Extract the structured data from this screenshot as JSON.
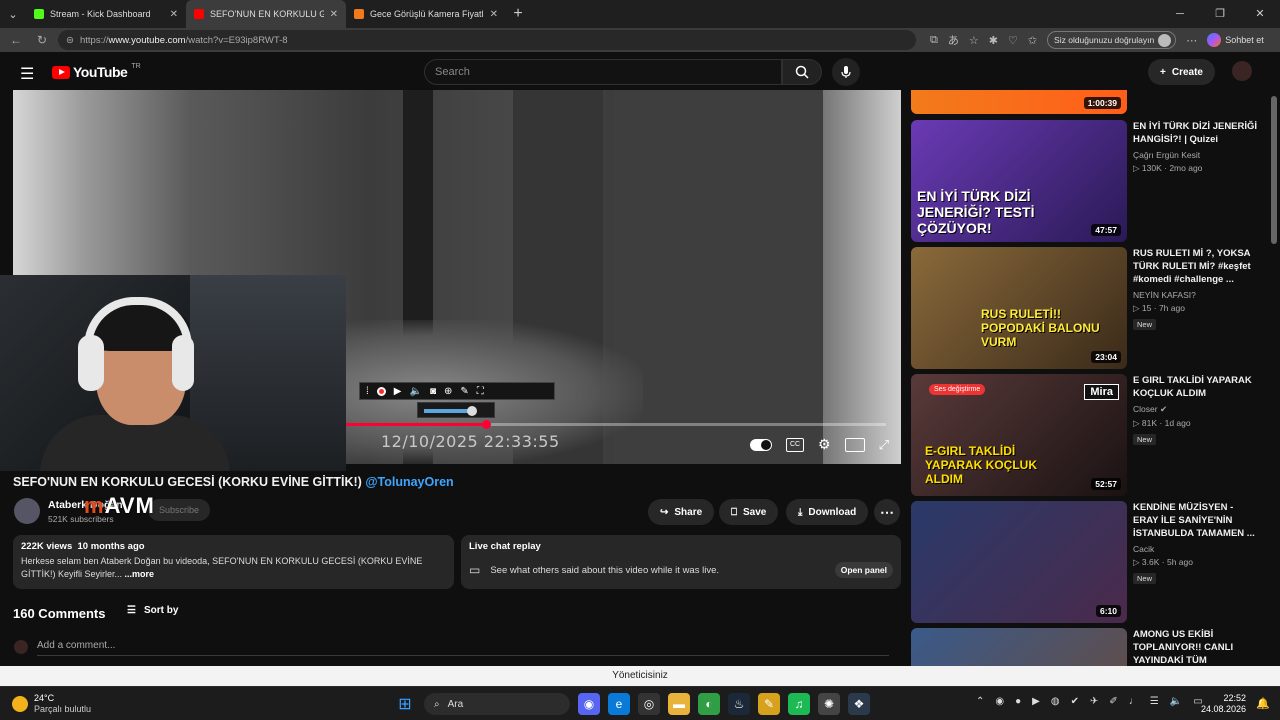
{
  "browser": {
    "tabs": [
      {
        "title": "Stream - Kick Dashboard",
        "favicon_color": "#53fc18",
        "active": false
      },
      {
        "title": "SEFO'NUN EN KORKULU GECESİ (K",
        "favicon_color": "#ff0000",
        "active": true
      },
      {
        "title": "Gece Görüşlü Kamera Fiyatları, Mo",
        "favicon_color": "#f27a1a",
        "active": false
      }
    ],
    "url_prefix": "https://",
    "url_host": "www.youtube.com",
    "url_path": "/watch?v=E93ip8RWT-8",
    "verify_label": "Siz olduğunuzu doğrulayın",
    "chat_label": "Sohbet et"
  },
  "youtube": {
    "logo_text": "YouTube",
    "logo_region": "TR",
    "search_placeholder": "Search",
    "create_label": "Create"
  },
  "player": {
    "timestamp": "12/10/2025 22:33:55",
    "progress_fraction": 0.26,
    "volume_fraction": 0.85,
    "cc_label": "CC",
    "hd_badge": "HD"
  },
  "video": {
    "title": "SEFO'NUN EN KORKULU GECESİ (KORKU EVİNE GİTTİK!)",
    "mention": "@TolunayOren",
    "channel_name": "Ataberk Doğan",
    "subscribers": "521K subscribers",
    "subscribe_label": "Subscribe",
    "overlay_logo_m": "m",
    "overlay_logo_rest": "AVM",
    "share_label": "Share",
    "save_label": "Save",
    "download_label": "Download",
    "views": "222K views",
    "age": "10 months ago",
    "description": "Herkese selam ben Ataberk Doğan bu videoda, SEFO'NUN EN KORKULU GECESİ (KORKU EVİNE GİTTİK!) Keyifli Seyirler...",
    "more_label": "...more",
    "chat_replay_title": "Live chat replay",
    "chat_replay_text": "See what others said about this video while it was live.",
    "open_panel_label": "Open panel"
  },
  "comments": {
    "count_label": "160 Comments",
    "sort_label": "Sort by",
    "add_placeholder": "Add a comment..."
  },
  "recommendations": {
    "top_duration": "1:00:39",
    "items": [
      {
        "title": "EN İYİ TÜRK DİZİ JENERİĞİ HANGİSİ?! | Quizei",
        "channel": "Çağrı Ergün Kesit",
        "views": "130K",
        "age": "2mo ago",
        "duration": "47:57",
        "new": "",
        "overlay": "EN İYİ TÜRK DİZİ JENERİĞİ? TESTİ ÇÖZÜYOR!",
        "bg": "#4a2a8a"
      },
      {
        "title": "RUS RULETI Mİ ?, YOKSA TÜRK RULETI Mİ? #keşfet #komedi #challenge ...",
        "channel": "NEYİN KAFASI?",
        "views": "15",
        "age": "7h ago",
        "duration": "23:04",
        "new": "New",
        "overlay": "RUS RULETİ!! POPODAKİ BALONU VURM",
        "bg": "#6a4a2a"
      },
      {
        "title": "E GIRL TAKLİDİ YAPARAK KOÇLUK ALDIM",
        "channel": "Closer",
        "views": "81K",
        "age": "1d ago",
        "duration": "52:57",
        "new": "New",
        "overlay": "E-GIRL TAKLİDİ YAPARAK KOÇLUK ALDIM",
        "bg": "#3a2424"
      },
      {
        "title": "KENDİNE MÜZİSYEN - ERAY İLE SANİYE'NİN İSTANBULDA TAMAMEN ...",
        "channel": "Cacik",
        "views": "3.6K",
        "age": "5h ago",
        "duration": "6:10",
        "new": "New",
        "overlay": "",
        "bg": "#3a2a3a"
      },
      {
        "title": "AMONG US EKİBİ TOPLANIYOR!! CANLI YAYINDAKİ TÜM ARAMALAR.",
        "channel": "",
        "views": "",
        "age": "",
        "duration": "",
        "new": "",
        "overlay": "",
        "bg": "#2a3a5a"
      }
    ],
    "mira_badge": "Mira",
    "ses_badge": "Ses değiştirme"
  },
  "status_strip": {
    "text": "Yöneticisiniz"
  },
  "taskbar": {
    "temperature": "24°C",
    "condition": "Parçalı bulutlu",
    "search_label": "Ara",
    "time": "22:52",
    "date": "24.08.2026"
  }
}
